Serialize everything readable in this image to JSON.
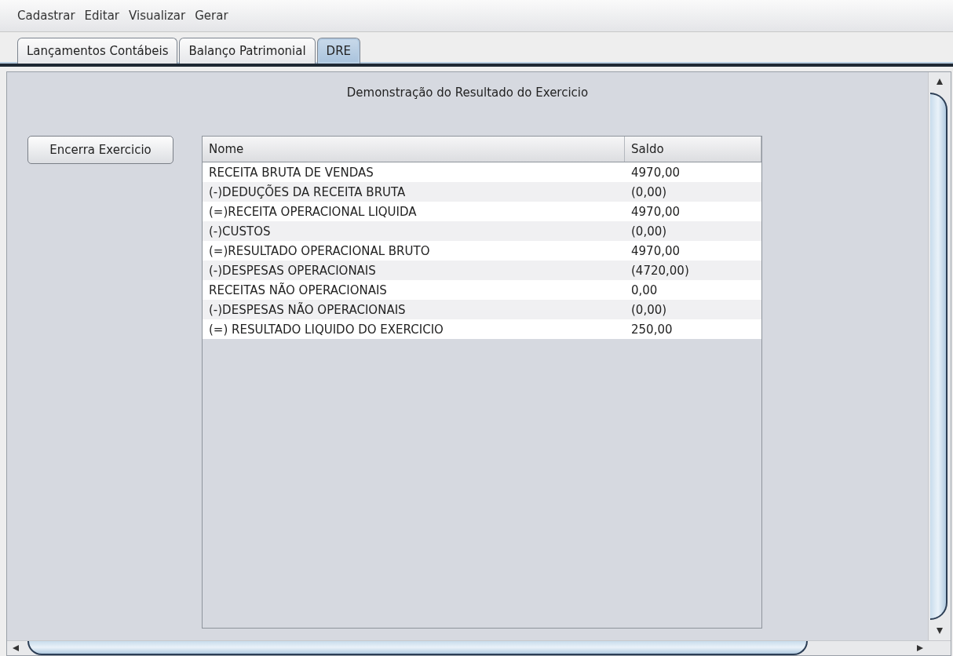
{
  "menu": [
    "Cadastrar",
    "Editar",
    "Visualizar",
    "Gerar"
  ],
  "tabs": [
    {
      "label": "Lançamentos Contábeis",
      "selected": false
    },
    {
      "label": "Balanço Patrimonial",
      "selected": false
    },
    {
      "label": "DRE",
      "selected": true
    }
  ],
  "title": "Demonstração do Resultado do Exercicio",
  "button": "Encerra Exercicio",
  "table": {
    "columns": [
      "Nome",
      "Saldo"
    ],
    "rows": [
      [
        "RECEITA BRUTA DE VENDAS",
        "4970,00"
      ],
      [
        "(-)DEDUÇÕES DA RECEITA BRUTA",
        "(0,00)"
      ],
      [
        "(=)RECEITA OPERACIONAL LIQUIDA",
        "4970,00"
      ],
      [
        "(-)CUSTOS",
        "(0,00)"
      ],
      [
        "(=)RESULTADO OPERACIONAL BRUTO",
        "4970,00"
      ],
      [
        "(-)DESPESAS OPERACIONAIS",
        "(4720,00)"
      ],
      [
        "RECEITAS NÃO OPERACIONAIS",
        "0,00"
      ],
      [
        "(-)DESPESAS NÃO OPERACIONAIS",
        "(0,00)"
      ],
      [
        "(=) RESULTADO LIQUIDO DO EXERCICIO",
        "250,00"
      ]
    ]
  }
}
